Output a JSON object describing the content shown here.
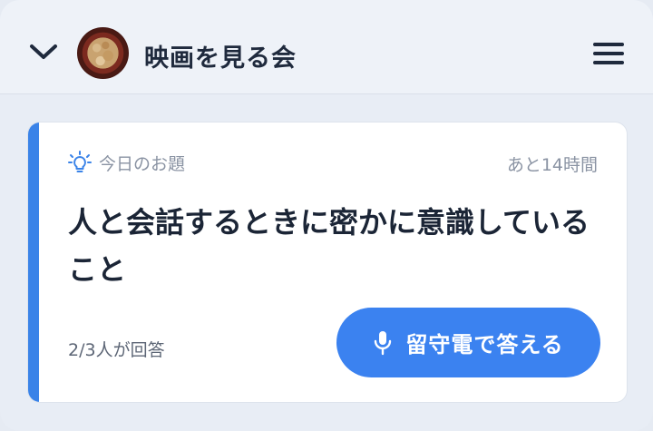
{
  "header": {
    "group_name": "映画を見る会",
    "collapse_icon": "chevron-down-icon",
    "menu_icon": "hamburger-menu-icon"
  },
  "topic_card": {
    "label": "今日のお題",
    "label_icon": "lightbulb-icon",
    "time_left": "あと14時間",
    "question": "人と会話するときに密かに意識していること",
    "answered_count": "2/3人が回答",
    "answer_button": {
      "label": "留守電で答える",
      "icon": "microphone-icon"
    }
  },
  "colors": {
    "accent": "#3a83e8",
    "button": "#3b82f0",
    "background": "#e8edf5"
  }
}
